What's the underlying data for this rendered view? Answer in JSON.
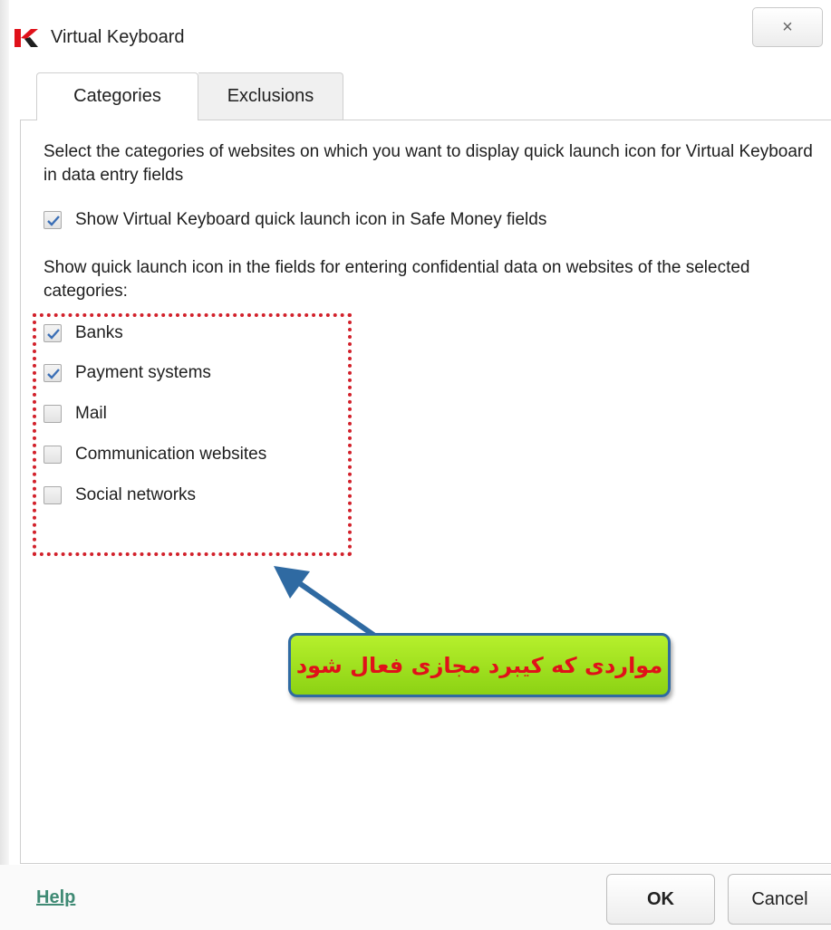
{
  "window": {
    "title": "Virtual Keyboard",
    "close_glyph": "×",
    "logo_icon": "kaspersky-k-logo"
  },
  "tabs": [
    {
      "label": "Categories",
      "active": true
    },
    {
      "label": "Exclusions",
      "active": false
    }
  ],
  "content": {
    "description": "Select the categories of websites on which you want to display quick launch icon for Virtual Keyboard in data entry fields",
    "safe_money": {
      "label": "Show Virtual Keyboard quick launch icon in Safe Money fields",
      "checked": true
    },
    "categories_intro": "Show quick launch icon in the fields for entering confidential data on websites of the selected categories:",
    "categories": [
      {
        "label": "Banks",
        "checked": true
      },
      {
        "label": "Payment systems",
        "checked": true
      },
      {
        "label": "Mail",
        "checked": false
      },
      {
        "label": "Communication websites",
        "checked": false
      },
      {
        "label": "Social networks",
        "checked": false
      }
    ]
  },
  "annotation": {
    "callout_text": "مواردی که کیبرد مجازی فعال شود",
    "callout_color": "#e0111a",
    "highlight_color": "#d2212b",
    "arrow_color": "#2f6aa2"
  },
  "footer": {
    "help": "Help",
    "ok": "OK",
    "cancel": "Cancel"
  }
}
